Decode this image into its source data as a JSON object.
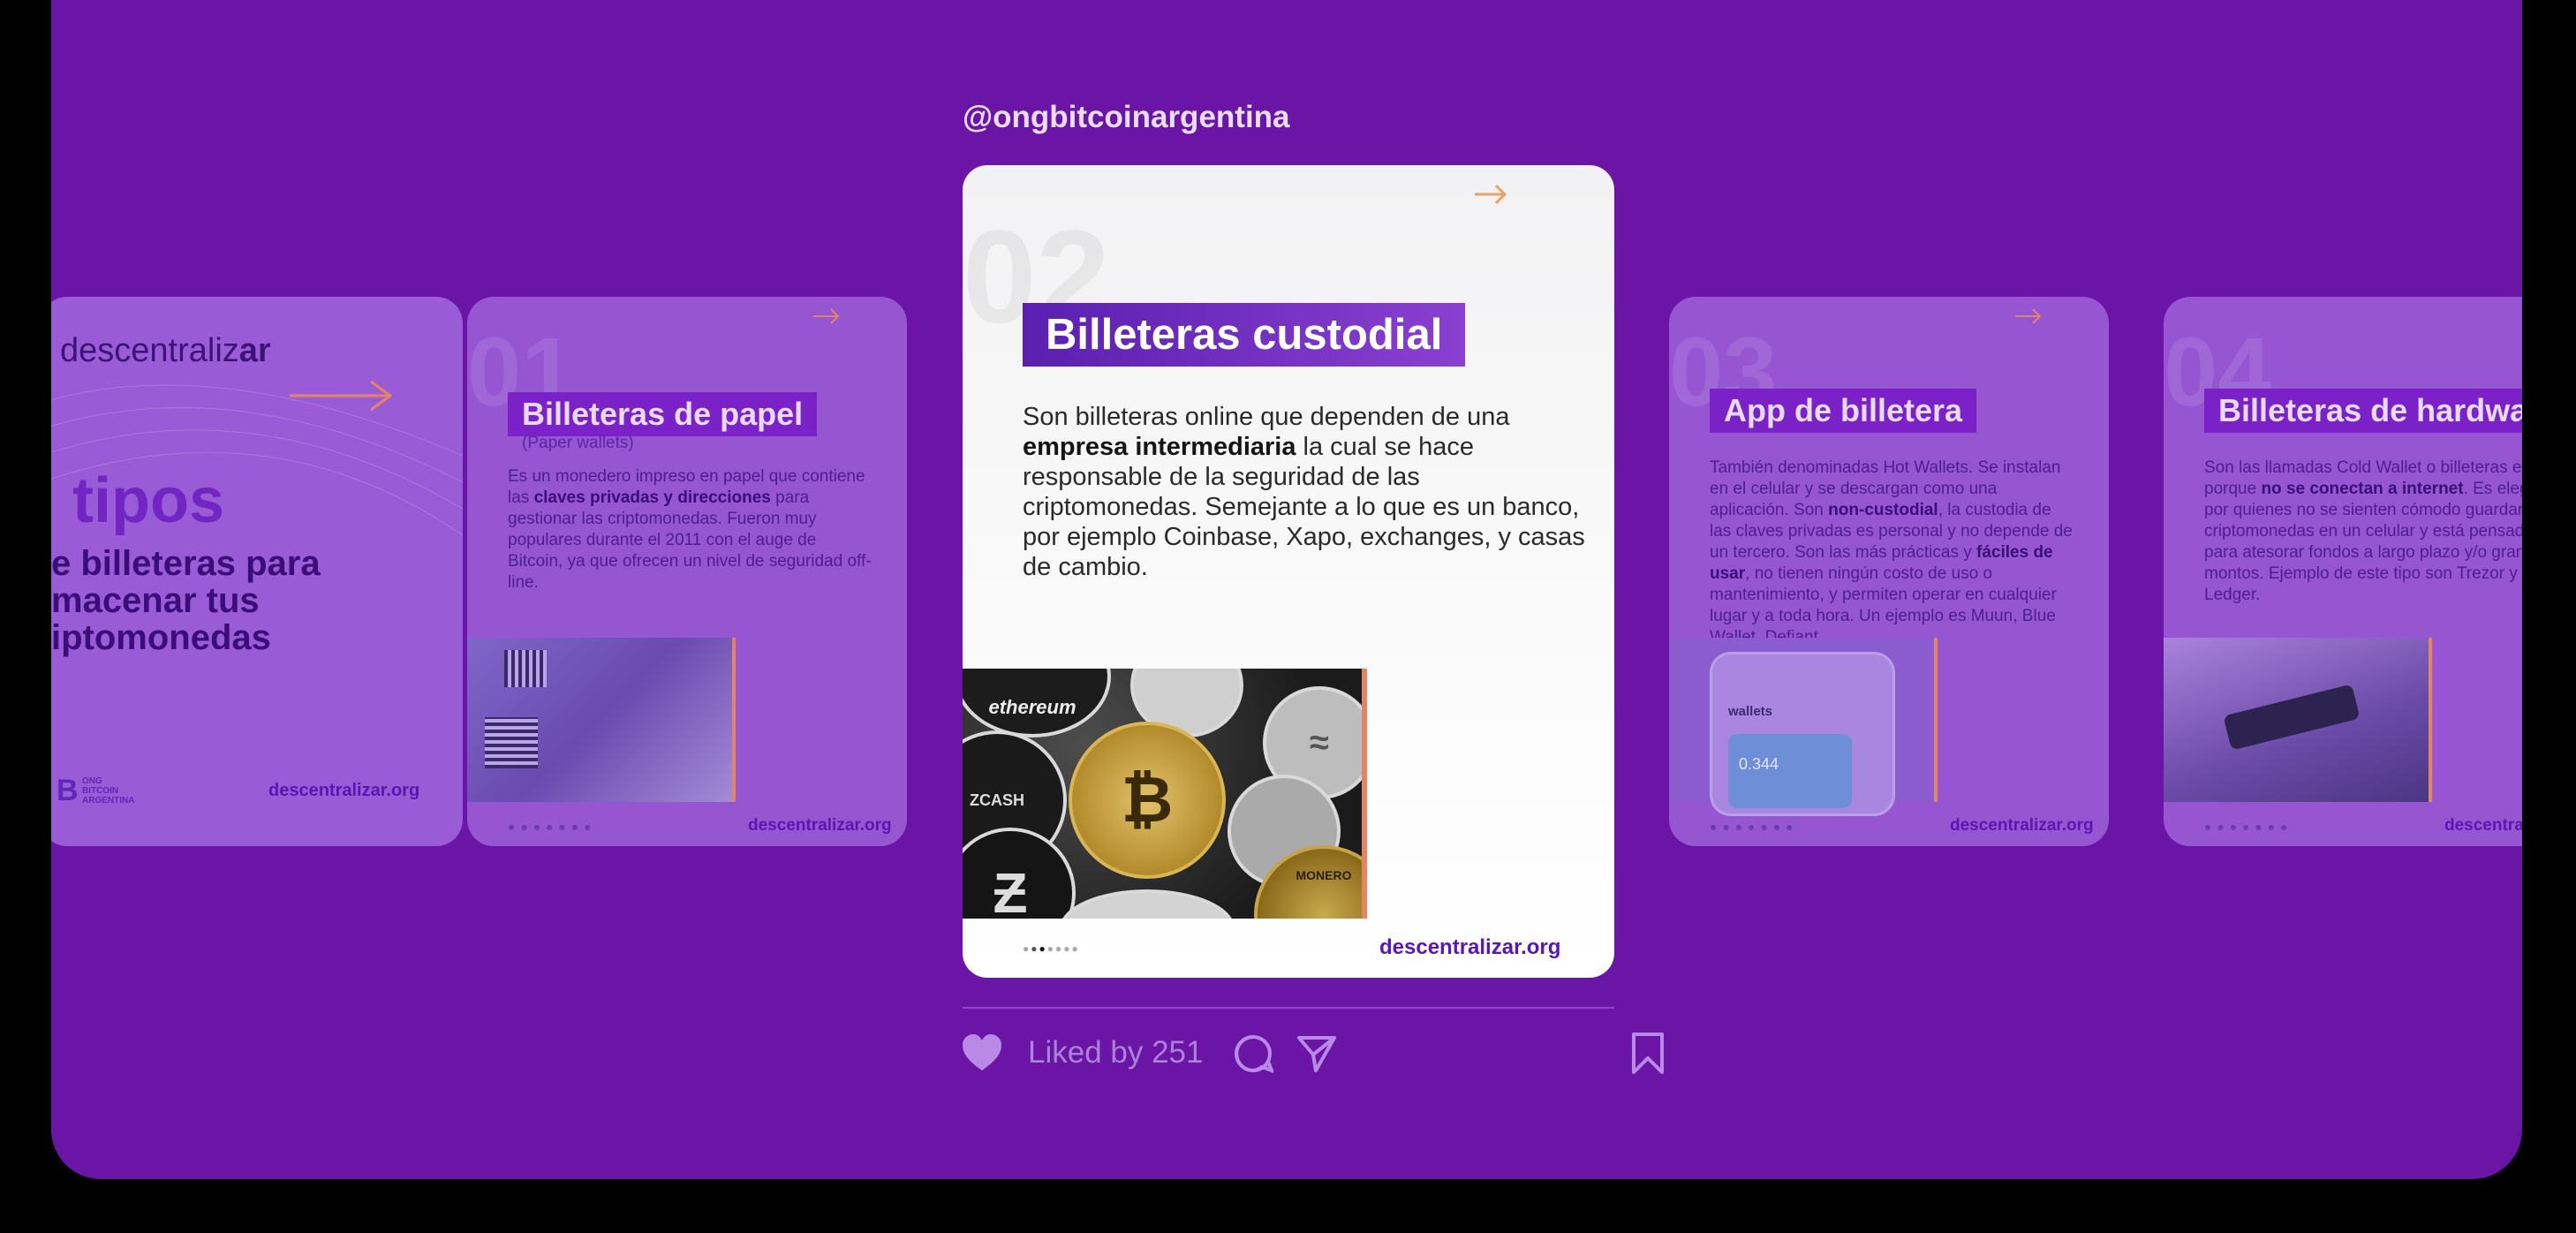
{
  "post": {
    "handle": "@ongbitcoinargentina",
    "likes_text": "Liked by 251"
  },
  "cards": {
    "intro": {
      "brand": "descentralizar",
      "brand_bold": "ar",
      "tipos": "tipos",
      "subtitle_line1": "e billeteras para",
      "subtitle_line2": "macenar tus",
      "subtitle_line3": "iptomonedas",
      "org_line1": "ONG",
      "org_line2": "BITCOIN",
      "org_line3": "ARGENTINA",
      "footer": "descentralizar.org"
    },
    "paper": {
      "number": "01",
      "title": "Billeteras de papel",
      "subtitle": "(Paper wallets)",
      "body_1": "Es un monedero impreso en papel que contiene las ",
      "body_bold": "claves privadas y direcciones",
      "body_2": " para gestionar las criptomonedas. Fueron muy populares durante el 2011 con el auge de Bitcoin, ya que ofrecen un nivel de seguridad off-line.",
      "footer": "descentralizar.org"
    },
    "custodial": {
      "number": "02",
      "title": "Billeteras custodial",
      "body_1": "Son billeteras online que dependen de una ",
      "body_bold": "empresa intermediaria",
      "body_2": " la cual se hace responsable de la seguridad de las criptomonedas. Semejante a lo que es un banco, por ejemplo Coinbase, Xapo, exchanges, y casas de cambio.",
      "coin_label_1": "ethereum",
      "coin_label_2": "ZCASH",
      "coin_label_3": "MONERO",
      "footer": "descentralizar.org"
    },
    "app": {
      "number": "03",
      "title": "App de billetera",
      "body_1": "También denominadas Hot Wallets. Se instalan en el celular y se descargan como una aplicación. Son ",
      "body_bold_1": "non-custodial",
      "body_2": ", la custodia de las claves privadas es personal y no depende de un tercero. Son las más prácticas y ",
      "body_bold_2": "fáciles de usar",
      "body_3": ", no tienen ningún costo de uso o mantenimiento, y permiten operar en cualquier lugar y a toda hora. Un ejemplo es Muun, Blue Wallet, Defiant.",
      "phone_label": "wallets",
      "phone_amount": "0.344",
      "footer": "descentralizar.org"
    },
    "hardware": {
      "number": "04",
      "title": "Billeteras de hardwa",
      "body_1": "Son las llamadas Cold Wallet o billeteras e frío porque ",
      "body_bold": "no se conectan a internet",
      "body_2": ". Es elegida por quienes no se sienten cómodo guardando criptomonedas en un celular y está pensada para atesorar fondos a largo plazo y/o grandes montos. Ejemplo de este tipo son Trezor y Ledger.",
      "footer": "descentralizar.org"
    }
  },
  "colors": {
    "background": "#6b15a7",
    "accent": "#7a22c8",
    "arrow": "#e9a26a",
    "photo_border": "#e48365"
  },
  "icons": [
    "heart-icon",
    "comment-icon",
    "share-icon",
    "bookmark-icon",
    "arrow-right-icon",
    "bitcoin-logo-icon"
  ]
}
